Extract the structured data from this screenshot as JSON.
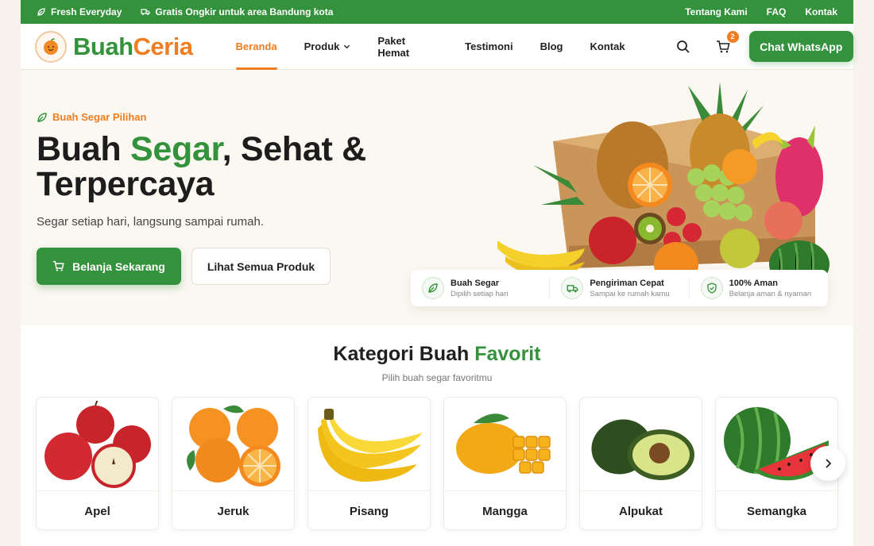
{
  "topbar": {
    "fresh": "Fresh Everyday",
    "shipping": "Gratis Ongkir untuk area Bandung kota",
    "links": [
      "Tentang Kami",
      "FAQ",
      "Kontak"
    ]
  },
  "brand": {
    "name_part1": "Buah",
    "name_part2": "Ceria"
  },
  "nav": {
    "items": [
      "Beranda",
      "Produk",
      "Paket Hemat",
      "Testimoni",
      "Blog",
      "Kontak"
    ],
    "active": "Beranda"
  },
  "header": {
    "cart_count": "2",
    "cta": "Chat WhatsApp"
  },
  "hero": {
    "eyebrow": "Buah Segar Pilihan",
    "title_part1": "Buah ",
    "title_highlight": "Segar",
    "title_part2": ", Sehat & Terpercaya",
    "subtitle": "Segar setiap hari, langsung sampai rumah.",
    "primary_cta": "Belanja Sekarang",
    "secondary_cta": "Lihat Semua Produk"
  },
  "features": [
    {
      "title": "Buah Segar",
      "desc": "Dipilih setiap hari",
      "icon": "leaf-icon"
    },
    {
      "title": "Pengiriman Cepat",
      "desc": "Sampai ke rumah kamu",
      "icon": "truck-icon"
    },
    {
      "title": "100% Aman",
      "desc": "Belanja aman & nyaman",
      "icon": "shield-icon"
    }
  ],
  "categories": {
    "title_part1": "Kategori Buah ",
    "title_highlight": "Favorit",
    "subtitle": "Pilih buah segar favoritmu",
    "items": [
      "Apel",
      "Jeruk",
      "Pisang",
      "Mangga",
      "Alpukat",
      "Semangka"
    ]
  },
  "colors": {
    "primary": "#35923c",
    "accent": "#ef7d22",
    "background": "#fbf8f2"
  }
}
